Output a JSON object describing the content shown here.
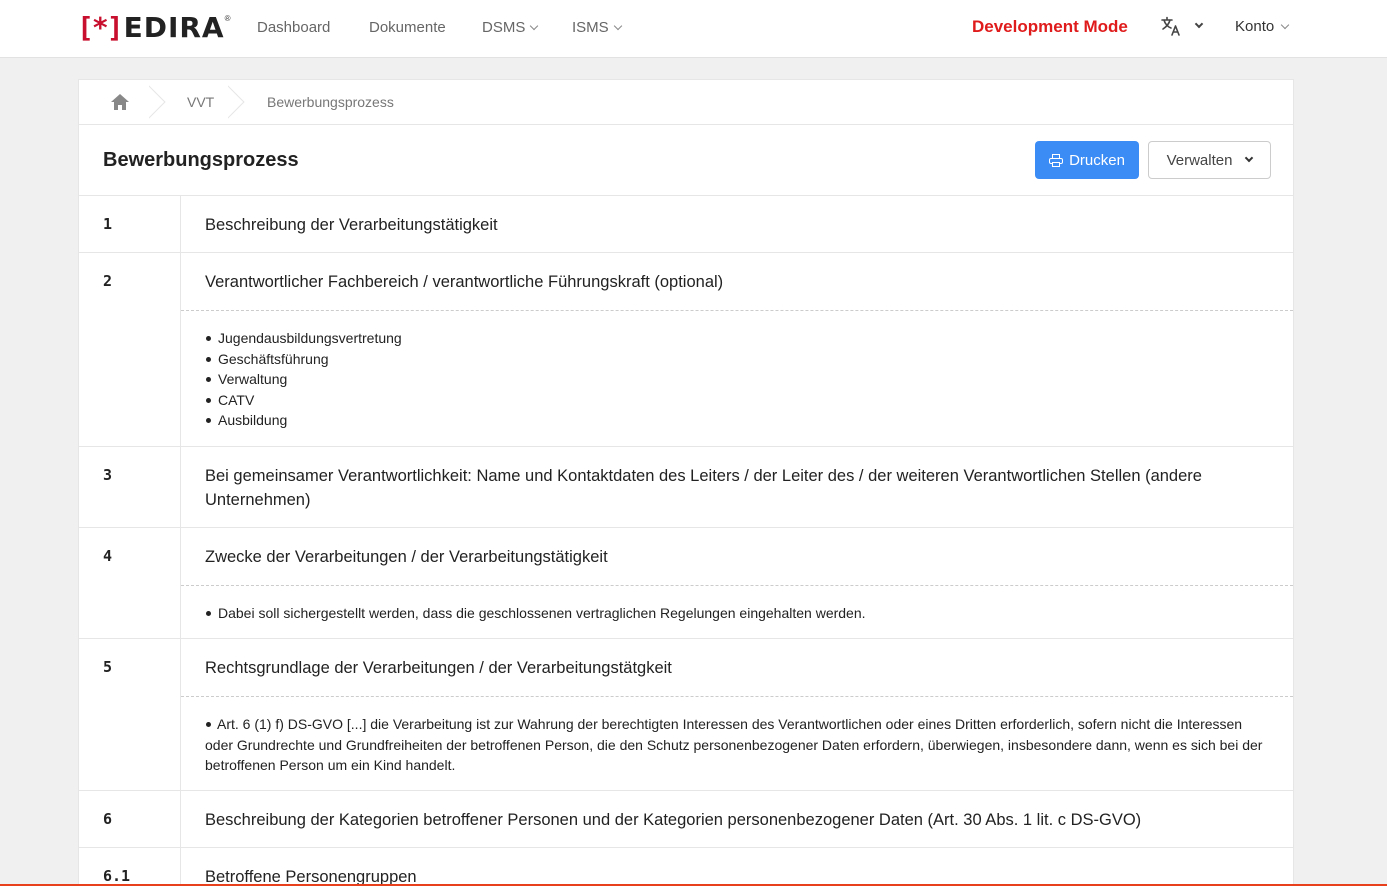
{
  "navbar": {
    "logo_mark": "[*]",
    "logo_text": "EDIRA",
    "logo_reg": "®",
    "links": [
      {
        "label": "Dashboard"
      },
      {
        "label": "Dokumente"
      },
      {
        "label": "DSMS"
      },
      {
        "label": "ISMS"
      }
    ],
    "dev_mode": "Development Mode",
    "lang_icon": "translate-icon",
    "account_label": "Konto"
  },
  "breadcrumb": {
    "home_icon": "home-icon",
    "items": [
      "VVT",
      "Bewerbungsprozess"
    ]
  },
  "header": {
    "title": "Bewerbungsprozess",
    "print_label": "Drucken",
    "manage_label": "Verwalten"
  },
  "rows": [
    {
      "num": "1",
      "title": "Beschreibung der Verarbeitungstätigkeit"
    },
    {
      "num": "2",
      "title": "Verantwortlicher Fachbereich / verantwortliche Führungskraft (optional)",
      "items": [
        "Jugendausbildungsvertretung",
        "Geschäftsführung",
        "Verwaltung",
        "CATV",
        "Ausbildung"
      ]
    },
    {
      "num": "3",
      "title": "Bei gemeinsamer Verantwortlichkeit: Name und Kontaktdaten des Leiters / der Leiter des / der weiteren Verantwortlichen Stellen (andere Unternehmen)"
    },
    {
      "num": "4",
      "title": "Zwecke der Verarbeitungen / der Verarbeitungstätigkeit",
      "items": [
        "Dabei soll sichergestellt werden, dass die geschlossenen vertraglichen Regelungen eingehalten werden."
      ]
    },
    {
      "num": "5",
      "title": "Rechtsgrundlage der Verarbeitungen / der Verarbeitungstätgkeit",
      "paragraph": "Art. 6 (1) f) DS-GVO [...] die Verarbeitung ist zur Wahrung der berechtigten Interessen des Verantwortlichen oder eines Dritten erforderlich, sofern nicht die Interessen oder Grundrechte und Grundfreiheiten der betroffenen Person, die den Schutz personenbezogener Daten erfordern, überwiegen, insbesondere dann, wenn es sich bei der betroffenen Person um ein Kind handelt."
    },
    {
      "num": "6",
      "title": "Beschreibung der Kategorien betroffener Personen und der Kategorien personenbezogener Daten (Art. 30 Abs. 1 lit. c DS-GVO)"
    },
    {
      "num": "6.1",
      "title": "Betroffene Personengruppen"
    }
  ],
  "colors": {
    "brand_red": "#c8102e",
    "dev_mode_red": "#e01b1b",
    "primary_blue": "#3b8cf5",
    "bottom_accent": "#e8401c"
  }
}
